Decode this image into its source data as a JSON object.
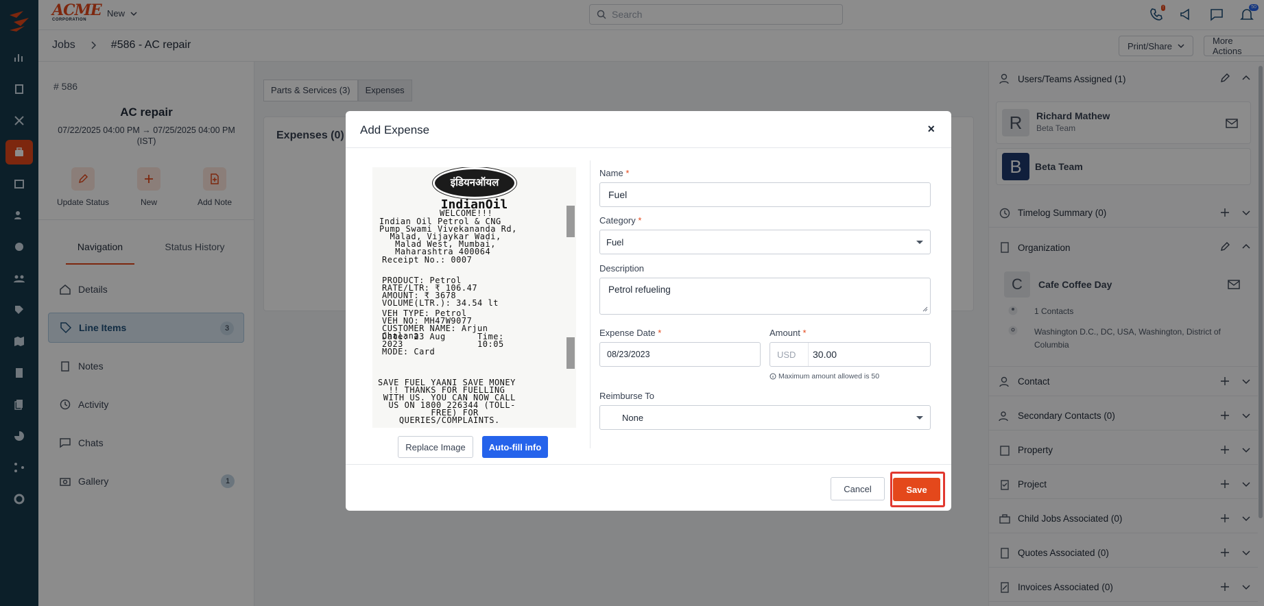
{
  "topbar": {
    "brand": "ACME",
    "brand_sub": "CORPORATION",
    "new_label": "New",
    "search_placeholder": "Search",
    "notif_count": "50"
  },
  "breadcrumb": {
    "root": "Jobs",
    "current": "#586 - AC repair",
    "print_share": "Print/Share",
    "more_actions": "More Actions"
  },
  "job": {
    "number": "# 586",
    "title": "AC repair",
    "date_line1": "07/22/2025 04:00 PM → 07/25/2025 04:00 PM",
    "date_line2": "(IST)",
    "actions": [
      {
        "label": "Update Status",
        "icon": "pencil-icon"
      },
      {
        "label": "New",
        "icon": "plus-icon"
      },
      {
        "label": "Add Note",
        "icon": "note-add-icon"
      }
    ]
  },
  "left_tabs": {
    "navigation": "Navigation",
    "status_history": "Status History"
  },
  "nav": [
    {
      "label": "Details",
      "icon": "home-icon"
    },
    {
      "label": "Line Items",
      "icon": "tag-icon",
      "count": "3",
      "active": true
    },
    {
      "label": "Notes",
      "icon": "clipboard-icon"
    },
    {
      "label": "Activity",
      "icon": "history-icon"
    },
    {
      "label": "Chats",
      "icon": "chat-icon"
    },
    {
      "label": "Gallery",
      "icon": "camera-icon",
      "count": "1"
    }
  ],
  "main": {
    "tabs": [
      "Parts & Services (3)",
      "Expenses"
    ],
    "expenses_header": "Expenses (0)"
  },
  "right": {
    "users_header": "Users/Teams Assigned (1)",
    "user1_initial": "R",
    "user1_name": "Richard Mathew",
    "user1_team": "Beta Team",
    "user2_initial": "B",
    "user2_name": "Beta Team",
    "timelog": "Timelog Summary (0)",
    "organization": "Organization",
    "org_initial": "C",
    "org_name": "Cafe Coffee Day",
    "org_contacts": "1 Contacts",
    "org_address_1": "Washington D.C., DC, USA, Washington, District of",
    "org_address_2": "Columbia",
    "sections": [
      "Contact",
      "Secondary Contacts (0)",
      "Property",
      "Project",
      "Child Jobs Associated (0)",
      "Quotes Associated (0)",
      "Invoices Associated (0)"
    ]
  },
  "modal": {
    "title": "Add Expense",
    "close": "×",
    "receipt": {
      "logo": "इंडियनऑयल",
      "brand": "IndianOil",
      "welcome": "WELCOME!!!",
      "block1": "Indian Oil Petrol & CNG\nPump Swami Vivekananda Rd,\n  Malad, Vijaykar Wadi,\n   Malad West, Mumbai,\n   Maharashtra 400064",
      "receipt_no": "Receipt No.: 0007",
      "block2": "PRODUCT: Petrol\nRATE/LTR: ₹ 106.47\nAMOUNT: ₹ 3678\nVOLUME(LTR.): 34.54 lt",
      "block3": "VEH TYPE: Petrol\nVEH NO: MH47W9077\nCUSTOMER NAME: Arjun\nChalana",
      "block4": "Date: 23 Aug      Time:\n2023              10:05\nMODE: Card",
      "block5": "SAVE FUEL YAANI SAVE MONEY\n  !! THANKS FOR FUELLING\n WITH US. YOU CAN NOW CALL\n  US ON 1800 226344 (TOLL-\n          FREE) FOR\n    QUERIES/COMPLAINTS."
    },
    "replace_image": "Replace Image",
    "autofill": "Auto-fill info",
    "name_label": "Name",
    "name_value": "Fuel",
    "category_label": "Category",
    "category_value": "Fuel",
    "description_label": "Description",
    "description_value": "Petrol refueling",
    "date_label": "Expense Date",
    "date_value": "08/23/2023",
    "amount_label": "Amount",
    "amount_currency": "USD",
    "amount_value": "30.00",
    "amount_hint": "Maximum amount allowed is 50",
    "reimburse_label": "Reimburse To",
    "reimburse_value": "None",
    "cancel": "Cancel",
    "save": "Save",
    "required_mark": "*"
  },
  "colors": {
    "accent": "#e4481b",
    "rail": "#17394b",
    "primary_blue": "#2563eb"
  }
}
